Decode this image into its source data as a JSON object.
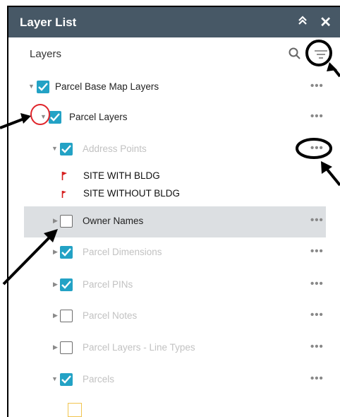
{
  "header": {
    "title": "Layer List",
    "collapse_icon": "double-chevron-up-icon",
    "close_icon": "close-icon"
  },
  "section": {
    "title": "Layers"
  },
  "menu_glyph": "•••",
  "layers": [
    {
      "name": "Parcel Base Map Layers",
      "checked": true,
      "expanded": true,
      "dim": false
    },
    {
      "name": "Parcel Layers",
      "checked": true,
      "expanded": true,
      "dim": false
    },
    {
      "name": "Address Points",
      "checked": true,
      "expanded": true,
      "dim": true
    },
    {
      "name": "Owner Names",
      "checked": false,
      "expanded": false,
      "dim": false,
      "highlighted": true
    },
    {
      "name": "Parcel Dimensions",
      "checked": true,
      "expanded": false,
      "dim": true
    },
    {
      "name": "Parcel PINs",
      "checked": true,
      "expanded": false,
      "dim": true
    },
    {
      "name": "Parcel Notes",
      "checked": false,
      "expanded": false,
      "dim": true
    },
    {
      "name": "Parcel Layers - Line Types",
      "checked": false,
      "expanded": false,
      "dim": true
    },
    {
      "name": "Parcels",
      "checked": true,
      "expanded": true,
      "dim": true
    }
  ],
  "legend": [
    {
      "label": "SITE WITH BLDG",
      "symbol": "red-flag-icon"
    },
    {
      "label": "SITE WITHOUT BLDG",
      "symbol": "red-flag-icon"
    }
  ],
  "colors": {
    "header": "#475866",
    "checkbox": "#23a2c5",
    "highlight": "#dcdfe2",
    "flag": "#d61e1e",
    "annotation_red": "#e0262c"
  }
}
